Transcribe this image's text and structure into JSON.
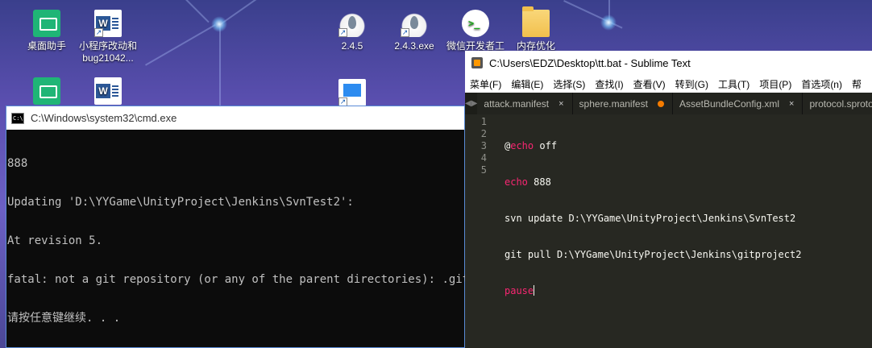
{
  "desktop": {
    "icons": [
      {
        "label_line1": "桌面助手",
        "label_line2": ""
      },
      {
        "label_line1": "小程序改动和",
        "label_line2": "bug21042..."
      },
      {
        "label_line1": "2.4.5",
        "label_line2": ""
      },
      {
        "label_line1": "2.4.3.exe",
        "label_line2": ""
      },
      {
        "label_line1": "微信开发者工",
        "label_line2": ""
      },
      {
        "label_line1": "内存优化",
        "label_line2": ""
      }
    ]
  },
  "cmd": {
    "title": "C:\\Windows\\system32\\cmd.exe",
    "icon_text": "C:\\",
    "lines": [
      "888",
      "Updating 'D:\\YYGame\\UnityProject\\Jenkins\\SvnTest2':",
      "At revision 5.",
      "fatal: not a git repository (or any of the parent directories): .git",
      "请按任意键继续. . ."
    ]
  },
  "sublime": {
    "title": "C:\\Users\\EDZ\\Desktop\\tt.bat - Sublime Text",
    "menu": [
      "菜单(F)",
      "编辑(E)",
      "选择(S)",
      "查找(I)",
      "查看(V)",
      "转到(G)",
      "工具(T)",
      "项目(P)",
      "首选项(n)",
      "帮"
    ],
    "tabs": [
      {
        "label": "attack.manifest",
        "marker": "×"
      },
      {
        "label": "sphere.manifest",
        "marker": "dot"
      },
      {
        "label": "AssetBundleConfig.xml",
        "marker": "×"
      },
      {
        "label": "protocol.sproto",
        "marker": ""
      }
    ],
    "line_numbers": [
      "1",
      "2",
      "3",
      "4",
      "5"
    ],
    "code": {
      "l1_at": "@",
      "l1_kw": "echo",
      "l1_rest": " off",
      "l2_kw": "echo",
      "l2_rest": " 888",
      "l3": "svn update D:\\YYGame\\UnityProject\\Jenkins\\SvnTest2",
      "l4": "git pull D:\\YYGame\\UnityProject\\Jenkins\\gitproject2",
      "l5_kw": "pause"
    }
  },
  "colors": {
    "keyword": "#f92672",
    "editor_bg": "#272822",
    "cmd_bg": "#0c0c0c"
  }
}
